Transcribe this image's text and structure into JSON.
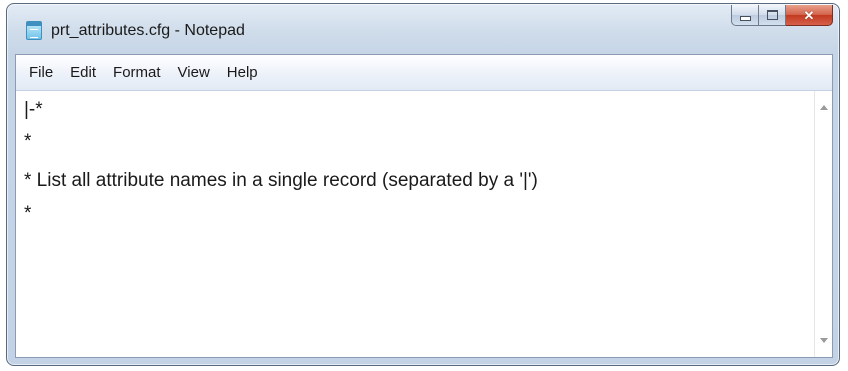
{
  "window": {
    "title": "prt_attributes.cfg - Notepad",
    "icon": "notepad-icon"
  },
  "caption_buttons": {
    "minimize_icon": "minimize-icon",
    "maximize_icon": "maximize-icon",
    "close_icon": "close-icon",
    "close_glyph": "✕"
  },
  "menu": {
    "items": [
      {
        "label": "File"
      },
      {
        "label": "Edit"
      },
      {
        "label": "Format"
      },
      {
        "label": "View"
      },
      {
        "label": "Help"
      }
    ]
  },
  "editor": {
    "lines": [
      "|-*",
      "*",
      "* List all attribute names in a single record (separated by a '|')",
      "*"
    ]
  },
  "scrollbar": {
    "up_icon": "scroll-up-arrow-icon",
    "down_icon": "scroll-down-arrow-icon"
  },
  "colors": {
    "title_bar": "#cfdcea",
    "close_button": "#c23a1f",
    "menu_bar": "#eef3fa"
  }
}
